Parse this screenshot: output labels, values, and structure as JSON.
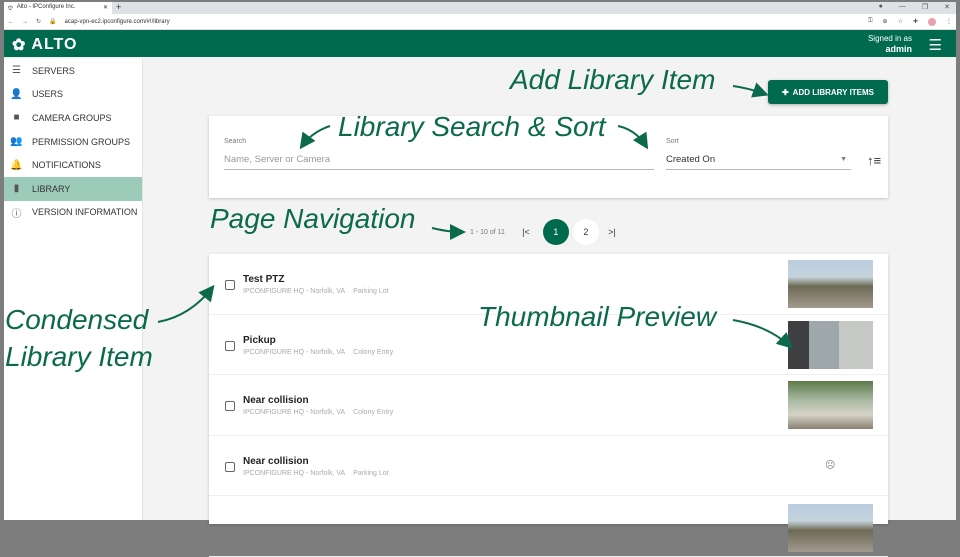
{
  "browser": {
    "tab_title": "Alto - IPConfigure Inc.",
    "url": "acap-vpn-ec2.ipconfigure.com/#!/library"
  },
  "header": {
    "logo": "ALTO",
    "signed_in_label": "Signed in as",
    "user": "admin"
  },
  "sidebar": {
    "items": [
      {
        "label": "SERVERS",
        "icon": "server-icon"
      },
      {
        "label": "USERS",
        "icon": "user-icon"
      },
      {
        "label": "CAMERA GROUPS",
        "icon": "camera-icon"
      },
      {
        "label": "PERMISSION GROUPS",
        "icon": "group-icon"
      },
      {
        "label": "NOTIFICATIONS",
        "icon": "bell-icon"
      },
      {
        "label": "LIBRARY",
        "icon": "bookmark-icon",
        "active": true
      },
      {
        "label": "VERSION INFORMATION",
        "icon": "info-icon"
      }
    ]
  },
  "toolbar": {
    "add_label": "ADD LIBRARY ITEMS"
  },
  "search": {
    "label": "Search",
    "placeholder": "Name, Server or Camera",
    "sort_label": "Sort",
    "sort_value": "Created On"
  },
  "pager": {
    "range": "1 - 10 of 11",
    "pages": [
      "1",
      "2"
    ],
    "current": "1"
  },
  "items": [
    {
      "title": "Test PTZ",
      "server": "IPCONFIGURE HQ - Norfolk, VA",
      "camera": "Parking Lot",
      "thumb": true
    },
    {
      "title": "Pickup",
      "server": "IPCONFIGURE HQ - Norfolk, VA",
      "camera": "Colony Entry",
      "thumb": true
    },
    {
      "title": "Near collision",
      "server": "IPCONFIGURE HQ - Norfolk, VA",
      "camera": "Colony Entry",
      "thumb": true
    },
    {
      "title": "Near collision",
      "server": "IPCONFIGURE HQ - Norfolk, VA",
      "camera": "Parking Lot",
      "thumb": false
    }
  ],
  "annotations": {
    "add": "Add Library Item",
    "search": "Library Search & Sort",
    "pager": "Page Navigation",
    "condensed1": "Condensed",
    "condensed2": "Library Item",
    "thumb": "Thumbnail Preview"
  },
  "colors": {
    "brand": "#006a4e",
    "annotation": "#0b6a4b",
    "active_nav": "#9ccbb9"
  }
}
